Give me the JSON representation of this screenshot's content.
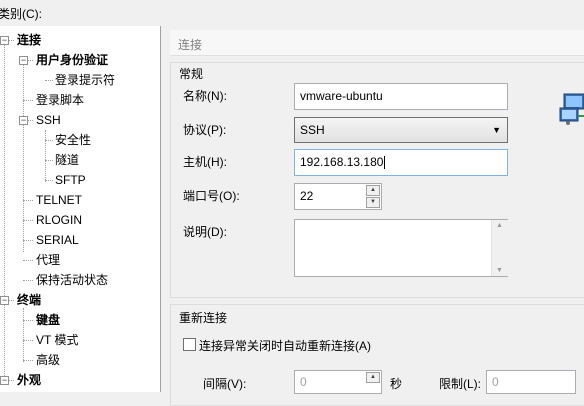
{
  "category_label": "类别(C):",
  "tree": {
    "items": [
      {
        "label": "连接",
        "bold": true
      },
      {
        "label": "用户身份验证",
        "bold": true
      },
      {
        "label": "登录提示符",
        "bold": false
      },
      {
        "label": "登录脚本",
        "bold": false
      },
      {
        "label": "SSH",
        "bold": false
      },
      {
        "label": "安全性",
        "bold": false
      },
      {
        "label": "隧道",
        "bold": false
      },
      {
        "label": "SFTP",
        "bold": false
      },
      {
        "label": "TELNET",
        "bold": false
      },
      {
        "label": "RLOGIN",
        "bold": false
      },
      {
        "label": "SERIAL",
        "bold": false
      },
      {
        "label": "代理",
        "bold": false
      },
      {
        "label": "保持活动状态",
        "bold": false
      },
      {
        "label": "终端",
        "bold": true
      },
      {
        "label": "键盘",
        "bold": true
      },
      {
        "label": "VT 模式",
        "bold": false
      },
      {
        "label": "高级",
        "bold": false
      },
      {
        "label": "外观",
        "bold": true
      }
    ]
  },
  "panel": {
    "header": "连接",
    "general": {
      "title": "常规",
      "name_label": "名称(N):",
      "name_value": "vmware-ubuntu",
      "protocol_label": "协议(P):",
      "protocol_value": "SSH",
      "host_label": "主机(H):",
      "host_value": "192.168.13.180",
      "port_label": "端口号(O):",
      "port_value": "22",
      "desc_label": "说明(D):",
      "desc_value": ""
    },
    "reconnect": {
      "title": "重新连接",
      "checkbox_label": "连接异常关闭时自动重新连接(A)",
      "checked": false,
      "interval_label": "间隔(V):",
      "interval_value": "0",
      "seconds_label": "秒",
      "limit_label": "限制(L):",
      "limit_value": "0"
    }
  },
  "icons": {
    "network_icon": "network-computers-icon"
  }
}
